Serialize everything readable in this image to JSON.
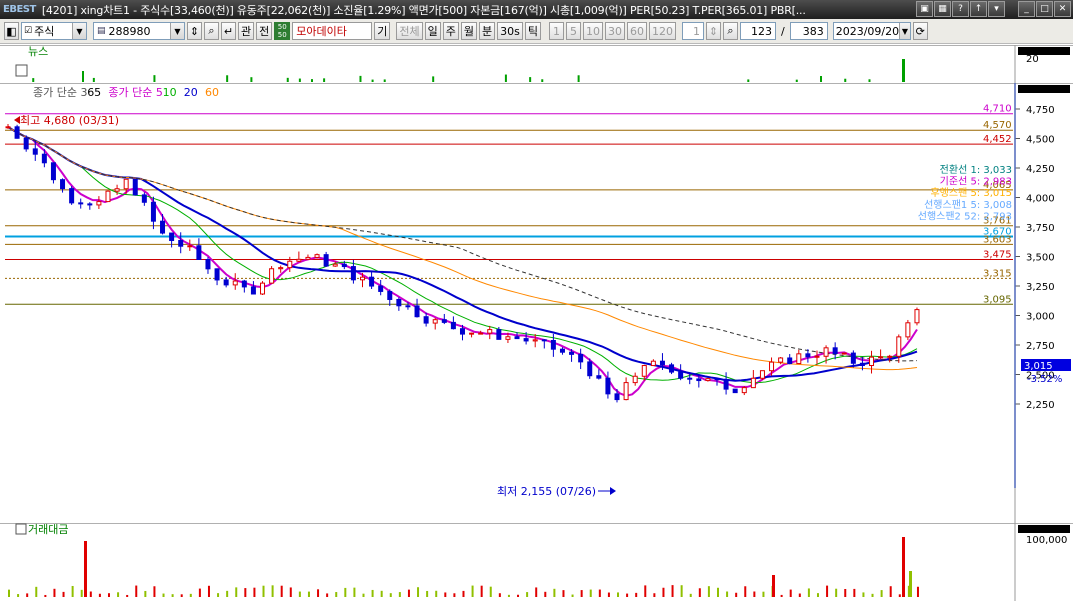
{
  "titlebar": {
    "logo": "EBEST",
    "title": "[4201] xing차트1 - 주식수[33,460(천)] 유동주[22,062(천)] 소진율[1.29%] 액면가[500] 자본금[167(억)] 시총[1,009(억)] PER[50.23] T.PER[365.01] PBR[..."
  },
  "toolbar": {
    "market": "주식",
    "code": "288980",
    "btn_gwan": "관",
    "btn_jeon": "전",
    "badge": "50",
    "data_select": "모아데이타",
    "btn_gi": "기",
    "btn_all": "전체",
    "periods": [
      "일",
      "주",
      "월",
      "분",
      "30s",
      "틱"
    ],
    "minutes": [
      "1",
      "5",
      "10",
      "30",
      "60",
      "120"
    ],
    "count_unit": "1",
    "visible_count": "123",
    "total_count": "383",
    "date": "2023/09/20"
  },
  "panels": {
    "news_label": "뉴스",
    "news_axis": "20",
    "vol_label": "거래대금",
    "vol_axis": "100,000"
  },
  "price_axis": [
    "4,750",
    "4,500",
    "4,250",
    "4,000",
    "3,750",
    "3,500",
    "3,250",
    "3,000",
    "2,750",
    "2,500",
    "2,250"
  ],
  "legend": {
    "ma_a_label": "종가 단순",
    "ma_a_period": "3",
    "ma_b_period": "65",
    "ma_c_label": "종가 단순",
    "ma_c_periods": [
      "5",
      "10",
      "20",
      "60"
    ]
  },
  "levels": [
    {
      "value": "4,710",
      "color": "#cc00cc"
    },
    {
      "value": "4,570",
      "color": "#996600"
    },
    {
      "value": "4,452",
      "color": "#cc0000"
    },
    {
      "value": "4,065",
      "color": "#996600"
    },
    {
      "value": "3,761",
      "color": "#996600"
    },
    {
      "value": "3,670",
      "color": "#00a0e0"
    },
    {
      "value": "3,603",
      "color": "#996600"
    },
    {
      "value": "3,475",
      "color": "#cc0000"
    },
    {
      "value": "3,315",
      "color": "#996600"
    },
    {
      "value": "3,095",
      "color": "#666600"
    }
  ],
  "ichimoku": [
    {
      "text": "전환선 1: 3,033",
      "color": "#008080"
    },
    {
      "text": "기준선 5: 2,983",
      "color": "#cc00cc"
    },
    {
      "text": "후행스팬 5: 3,015",
      "color": "#ffb000"
    },
    {
      "text": "선행스팬1 5: 3,008",
      "color": "#66aaff"
    },
    {
      "text": "선행스팬2 52: 2,793",
      "color": "#66aaff"
    }
  ],
  "annotations": {
    "high": "최고 4,680 (03/31)",
    "low": "최저 2,155 (07/26)"
  },
  "current": {
    "price": "3,015",
    "change": "-3.52%"
  }
}
